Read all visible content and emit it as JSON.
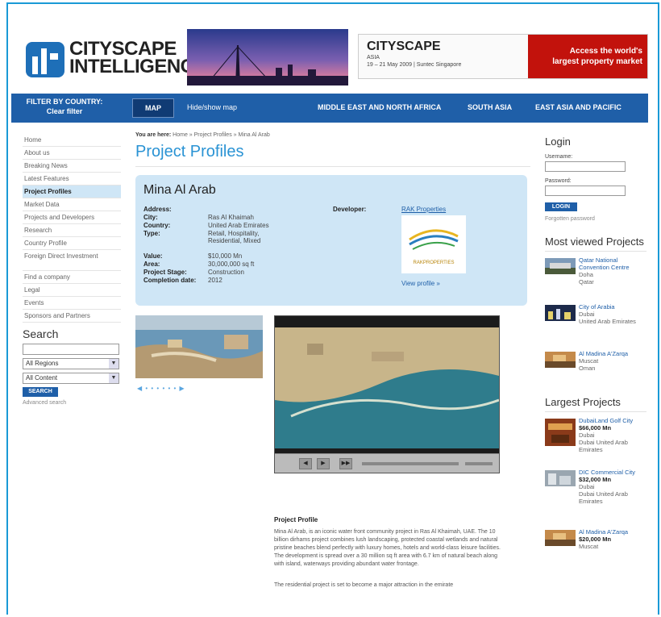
{
  "header": {
    "logo_line1": "CITYSCAPE",
    "logo_line2": "INTELLIGENCE",
    "ad": {
      "title": "CITYSCAPE",
      "subtitle": "ASIA",
      "dates": "19 – 21 May 2009 | Suntec Singapore",
      "tagline_line1": "Access the world's",
      "tagline_line2": "largest property market"
    }
  },
  "nav": {
    "filter_label": "FILTER BY COUNTRY:",
    "clear_filter": "Clear filter",
    "map_button": "MAP",
    "hide_map": "Hide/show map",
    "regions": [
      "MIDDLE EAST AND NORTH AFRICA",
      "SOUTH ASIA",
      "EAST ASIA AND PACIFIC"
    ]
  },
  "sidebar": {
    "items": [
      "Home",
      "About us",
      "Breaking News",
      "Latest Features",
      "Project Profiles",
      "Market Data",
      "Projects and Developers",
      "Research",
      "Country Profile",
      "Foreign Direct Investment",
      "Find a company",
      "Legal",
      "Events",
      "Sponsors and Partners"
    ],
    "active_index": 4,
    "search": {
      "title": "Search",
      "regions": "All Regions",
      "content": "All Content",
      "button": "SEARCH",
      "advanced": "Advanced search"
    }
  },
  "main": {
    "breadcrumb_label": "You are here:",
    "breadcrumb_path": "Home » Project Profiles » Mina Al Arab",
    "page_title": "Project Profiles",
    "project": {
      "name": "Mina Al Arab",
      "fields": [
        {
          "label": "Address:",
          "value": ""
        },
        {
          "label": "City:",
          "value": "Ras Al Khaimah"
        },
        {
          "label": "Country:",
          "value": "United Arab Emirates"
        },
        {
          "label": "Type:",
          "value": "Retail, Hospitality, Residential, Mixed"
        },
        {
          "label": "Value:",
          "value": "$10,000 Mn"
        },
        {
          "label": "Area:",
          "value": "30,000,000 sq ft"
        },
        {
          "label": "Project Stage:",
          "value": "Construction"
        },
        {
          "label": "Completion date:",
          "value": "2012"
        }
      ],
      "developer_label": "Developer:",
      "developer_name": "RAK Properties",
      "developer_logo_text": "RAKPROPERTIES",
      "view_profile": "View profile »"
    },
    "thumb_nav": "◀ • • • • • • ▶",
    "description": {
      "title": "Project Profile",
      "text": "Mina Al Arab, is an iconic water front community project in Ras Al Khaimah, UAE. The 10 billion dirhams project combines lush landscaping, protected coastal wetlands and natural pristine beaches blend perfectly with luxury homes, hotels and world-class leisure facilities. The development is spread over a 30 million sq ft area with 6.7 km of natural beach along with island, waterways providing abundant water frontage.",
      "text2": "The residential project is set to become a major attraction in the emirate"
    }
  },
  "right": {
    "login": {
      "title": "Login",
      "username": "Username:",
      "password": "Password:",
      "button": "LOGIN",
      "forgot": "Forgotten password"
    },
    "most_viewed_title": "Most viewed Projects",
    "most_viewed": [
      {
        "name": "Qatar National Convention Centre",
        "city": "Doha",
        "country": "Qatar"
      },
      {
        "name": "City of Arabia",
        "city": "Dubai",
        "country": "United Arab Emirates"
      },
      {
        "name": "Al Madina A'Zarqa",
        "city": "Muscat",
        "country": "Oman"
      }
    ],
    "largest_title": "Largest Projects",
    "largest": [
      {
        "name": "DubaiLand Golf City",
        "price": "$66,000 Mn",
        "city": "Dubai",
        "country": "Dubai United Arab Emirates"
      },
      {
        "name": "DIC Commercial City",
        "price": "$32,000 Mn",
        "city": "Dubai",
        "country": "Dubai United Arab Emirates"
      },
      {
        "name": "Al Madina A'Zarqa",
        "price": "$20,000 Mn",
        "city": "Muscat",
        "country": ""
      }
    ]
  }
}
